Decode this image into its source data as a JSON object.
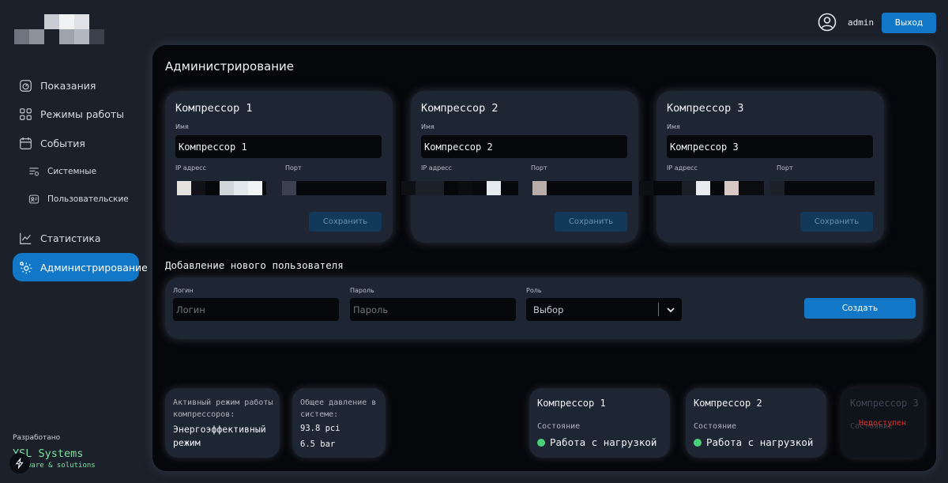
{
  "header": {
    "username": "admin",
    "logout_label": "Выход"
  },
  "sidebar": {
    "items": [
      {
        "label": "Показания",
        "icon": "gauge-icon"
      },
      {
        "label": "Режимы работы",
        "icon": "grid-icon"
      },
      {
        "label": "События",
        "icon": "calendar-icon"
      },
      {
        "label": "Системные",
        "icon": "list-settings-icon"
      },
      {
        "label": "Пользовательские",
        "icon": "user-card-icon"
      },
      {
        "label": "Статистика",
        "icon": "chart-line-icon"
      },
      {
        "label": "Администрирование",
        "icon": "admin-gear-icon",
        "active": true
      }
    ],
    "developer_label": "Разработано",
    "developer_brand": "YSL Systems",
    "developer_sub": "ware & solutions"
  },
  "main": {
    "title": "Администрирование",
    "compressors": [
      {
        "title": "Компрессор 1",
        "name_label": "Имя",
        "name_value": "Компрессор 1",
        "ip_label": "IP адресс",
        "port_label": "Порт",
        "save_label": "Сохранить"
      },
      {
        "title": "Компрессор 2",
        "name_label": "Имя",
        "name_value": "Компрессор 2",
        "ip_label": "IP адресс",
        "port_label": "Порт",
        "save_label": "Сохранить"
      },
      {
        "title": "Компрессор 3",
        "name_label": "Имя",
        "name_value": "Компрессор 3",
        "ip_label": "IP адресс",
        "port_label": "Порт",
        "save_label": "Сохранить"
      }
    ],
    "add_user": {
      "title": "Добавление нового пользователя",
      "login_label": "Логин",
      "login_placeholder": "Логин",
      "password_label": "Пароль",
      "password_placeholder": "Пароль",
      "role_label": "Роль",
      "role_value": "Выбор",
      "create_label": "Создать"
    },
    "status": {
      "mode_caption": "Активный режим работы компрессоров:",
      "mode_value": "Энергоэффективный режим",
      "pressure_caption": "Общее давление в системе:",
      "pressure_psi": "93.8 pci",
      "pressure_bar": "6.5 bar",
      "cards": [
        {
          "title": "Компрессор 1",
          "state_label": "Состояние",
          "state_value": "Работа с нагрузкой"
        },
        {
          "title": "Компрессор 2",
          "state_label": "Состояние",
          "state_value": "Работа с нагрузкой"
        },
        {
          "title": "Компрессор 3",
          "state_label": "Состояние",
          "error": "Недоступен"
        }
      ]
    }
  },
  "colors": {
    "accent": "#1177c6",
    "ok": "#4bd07a",
    "error": "#e0342f",
    "dev": "#7fe0a0"
  }
}
